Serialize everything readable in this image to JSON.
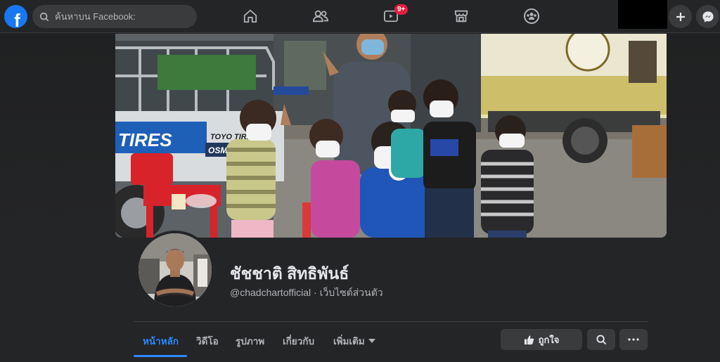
{
  "topbar": {
    "logo_letter": "f",
    "search_placeholder": "ค้นหาบน Facebook:",
    "nav_icons": [
      "home-icon",
      "friends-icon",
      "watch-icon",
      "marketplace-icon",
      "groups-icon"
    ],
    "watch_badge": "9+",
    "right_icons": [
      "plus-icon",
      "messenger-icon"
    ]
  },
  "page": {
    "name": "ชัชชาติ สิทธิพันธ์",
    "handle_line": "@chadchartofficial · เว็บไซต์ส่วนตัว"
  },
  "cover_text": {
    "tires": "TIRES",
    "toyo": "TOYO TIRE",
    "osm": "OSM"
  },
  "tabs": [
    {
      "label": "หน้าหลัก",
      "active": true
    },
    {
      "label": "วิดีโอ",
      "active": false
    },
    {
      "label": "รูปภาพ",
      "active": false
    },
    {
      "label": "เกี่ยวกับ",
      "active": false
    },
    {
      "label": "เพิ่มเติม",
      "active": false
    }
  ],
  "actions": {
    "like_label": "ถูกใจ",
    "search_icon": "search-icon",
    "more_icon": "more-icon"
  },
  "colors": {
    "accent": "#2d88ff",
    "brand": "#1877f2",
    "badge": "#e41e3f",
    "background": "#18191a"
  }
}
